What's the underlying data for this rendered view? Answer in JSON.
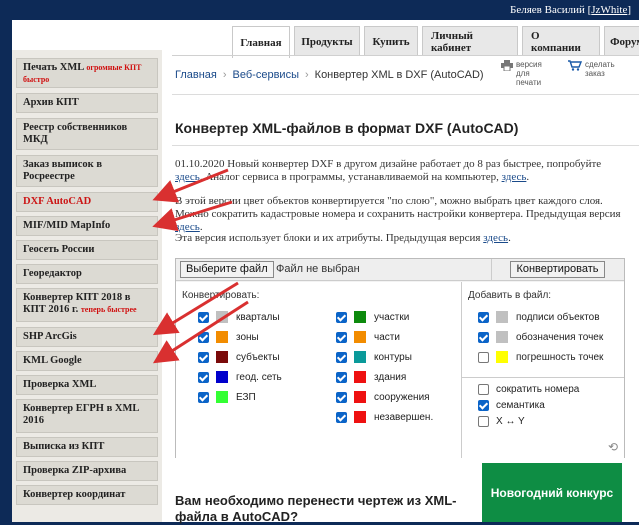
{
  "header": {
    "user_name": "Беляев Василий",
    "user_link": "JzWhite",
    "bracket_open": "[",
    "bracket_close": "]"
  },
  "tabs": [
    {
      "label": "Главная",
      "active": true
    },
    {
      "label": "Продукты"
    },
    {
      "label": "Купить"
    },
    {
      "label": "Личный кабинет"
    },
    {
      "label": "О компании"
    },
    {
      "label": "Форум"
    }
  ],
  "sidebar": {
    "items": [
      {
        "label": "Печать XML",
        "sup": "огромные КПТ быстро"
      },
      {
        "label": "Архив КПТ"
      },
      {
        "label": "Реестр собственников МКД"
      },
      {
        "label": "Заказ выписок в Росреестре"
      },
      {
        "label": "DXF AutoCAD"
      },
      {
        "label": "MIF/MID MapInfo"
      },
      {
        "label": "Геосеть России"
      },
      {
        "label": "Георедактор"
      },
      {
        "label": "Конвертер КПТ 2018 в КПТ 2016 г.",
        "sup": "теперь быстрее"
      },
      {
        "label": "SHP ArcGis"
      },
      {
        "label": "KML Google"
      },
      {
        "label": "Проверка XML"
      },
      {
        "label": "Конвертер ЕГРН в XML 2016"
      },
      {
        "label": "Выписка из КПТ"
      },
      {
        "label": "Проверка ZIP-архива"
      },
      {
        "label": "Конвертер координат"
      }
    ]
  },
  "breadcrumb": {
    "home": "Главная",
    "services": "Веб-сервисы",
    "current": "Конвертер XML в DXF (AutoCAD)",
    "sep": "›"
  },
  "tools": {
    "print_label": "версия для печати",
    "order_label": "сделать заказ"
  },
  "main": {
    "title": "Конвертер XML-файлов в формат DXF (AutoCAD)",
    "p1_text": "01.10.2020 Новый конвертер DXF в другом дизайне работает до 8 раз быстрее, попробуйте",
    "p1_link": "здесь",
    "p1_text2": "Аналог сервиса в программы, устанавливаемой на компьютер,",
    "p1_link2": "здесь",
    "p2_text": "В этой версии цвет объектов конвертируется \"по слою\", можно выбрать цвет каждого слоя. Можно сократить кадастровые номера и сохранить настройки конвертера. Предыдущая версия",
    "p2_link": "здесь",
    "p3_text": "Эта версия использует блоки и их атрибуты. Предыдущая версия",
    "p3_link": "здесь",
    "question": "Вам необходимо перенести чертеж из XML-файла в AutoCAD?",
    "promo": "Новогодний конкурс"
  },
  "converter": {
    "choose_file": "Выберите файл",
    "no_file": "Файл не выбран",
    "convert": "Конвертировать",
    "convert_title": "Конвертировать:",
    "add_title": "Добавить в файл:",
    "col1": [
      {
        "label": "кварталы",
        "checked": true,
        "color": "#c0c0c0"
      },
      {
        "label": "зоны",
        "checked": true,
        "color": "#f28c00"
      },
      {
        "label": "субъекты",
        "checked": true,
        "color": "#7a0a0a"
      },
      {
        "label": "геод. сеть",
        "checked": true,
        "color": "#0000cc"
      },
      {
        "label": "ЕЗП",
        "checked": true,
        "color": "#33ff33"
      }
    ],
    "col2": [
      {
        "label": "участки",
        "checked": true,
        "color": "#0d8a0d"
      },
      {
        "label": "части",
        "checked": true,
        "color": "#f28c00"
      },
      {
        "label": "контуры",
        "checked": true,
        "color": "#0a9a9a"
      },
      {
        "label": "здания",
        "checked": true,
        "color": "#ee1111"
      },
      {
        "label": "сооружения",
        "checked": true,
        "color": "#ee1111"
      },
      {
        "label": "незавершен.",
        "checked": true,
        "color": "#ee1111"
      }
    ],
    "add": [
      {
        "label": "подписи объектов",
        "checked": true,
        "color": "#c0c0c0"
      },
      {
        "label": "обозначения точек",
        "checked": true,
        "color": "#c0c0c0"
      },
      {
        "label": "погрешность точек",
        "checked": false,
        "color": "#ffff00"
      }
    ],
    "extra": [
      {
        "label": "сократить номера",
        "checked": false
      },
      {
        "label": "семантика",
        "checked": true
      },
      {
        "label": "X ↔ Y",
        "checked": false
      }
    ]
  },
  "colors": {
    "accent_red": "#d93030",
    "header_navy": "#0d2a57",
    "promo_green": "#0e8d44"
  }
}
